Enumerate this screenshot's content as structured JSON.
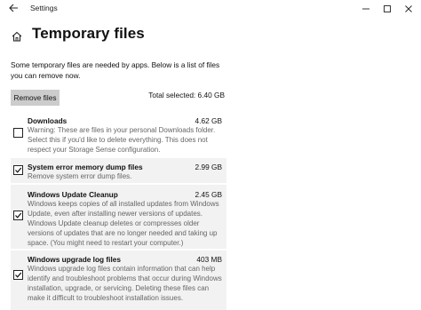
{
  "window": {
    "back_icon": "back-arrow-icon",
    "title": "Settings",
    "controls": [
      "minimize-icon",
      "maximize-icon",
      "close-icon"
    ]
  },
  "page": {
    "home_icon": "home-icon",
    "title": "Temporary files",
    "intro": "Some temporary files are needed by apps. Below is a list of files you can remove now.",
    "remove_button": "Remove files",
    "total_selected": "Total selected: 6.40 GB"
  },
  "items": [
    {
      "title": "Downloads",
      "size": "4.62 GB",
      "checked": false,
      "description": "Warning: These are files in your personal Downloads folder. Select this if you'd like to delete everything. This does not respect your Storage Sense configuration."
    },
    {
      "title": "System error memory dump files",
      "size": "2.99 GB",
      "checked": true,
      "description": "Remove system error dump files."
    },
    {
      "title": "Windows Update Cleanup",
      "size": "2.45 GB",
      "checked": true,
      "description": "Windows keeps copies of all installed updates from Windows Update, even after installing newer versions of updates. Windows Update cleanup deletes or compresses older versions of updates that are no longer needed and taking up space. (You might need to restart your computer.)"
    },
    {
      "title": "Windows upgrade log files",
      "size": "403 MB",
      "checked": true,
      "description": "Windows upgrade log files contain information that can help identify and troubleshoot problems that occur during Windows installation, upgrade, or servicing.  Deleting these files can make it difficult to troubleshoot installation issues."
    }
  ]
}
